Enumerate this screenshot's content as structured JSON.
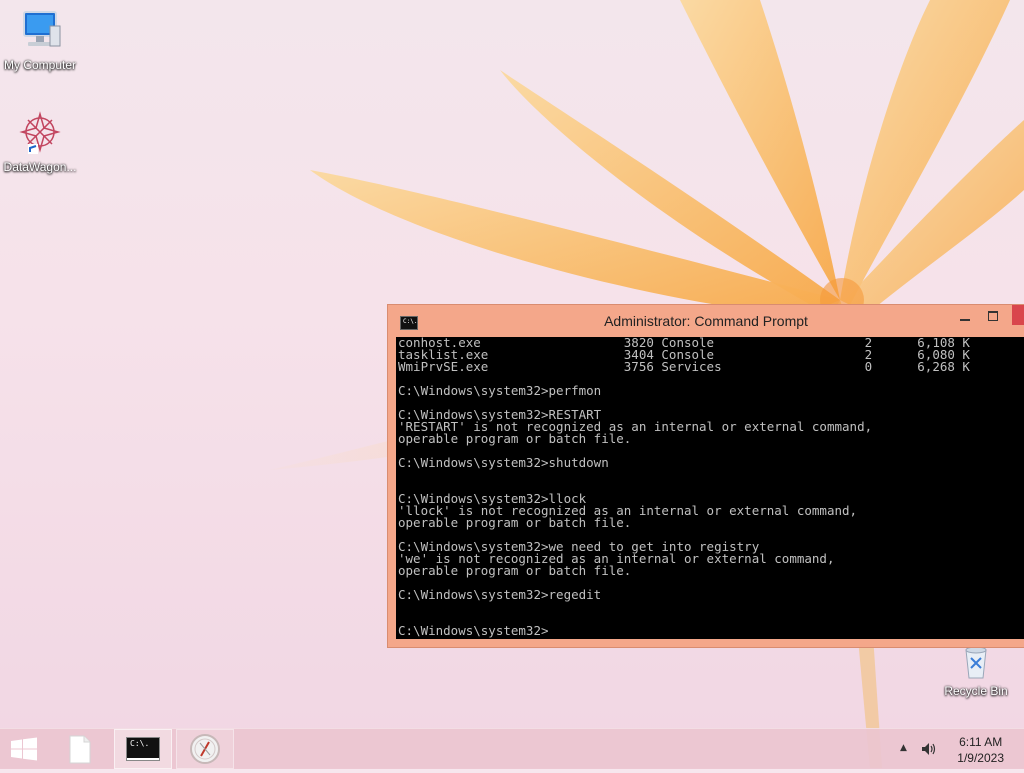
{
  "desktop": {
    "icons": [
      {
        "label": "My Computer",
        "icon": "computer-icon"
      },
      {
        "label": "DataWagon...",
        "icon": "datawagon-icon"
      },
      {
        "label": "Recycle Bin",
        "icon": "recycle-bin-icon"
      }
    ]
  },
  "cmd_window": {
    "title": "Administrator:  Command Prompt",
    "icon": "cmd-icon",
    "sys_icon_text": "C:\\.",
    "lines": [
      "conhost.exe                   3820 Console                    2      6,108 K",
      "tasklist.exe                  3404 Console                    2      6,080 K",
      "WmiPrvSE.exe                  3756 Services                   0      6,268 K",
      "",
      "C:\\Windows\\system32>perfmon",
      "",
      "C:\\Windows\\system32>RESTART",
      "'RESTART' is not recognized as an internal or external command,",
      "operable program or batch file.",
      "",
      "C:\\Windows\\system32>shutdown",
      "",
      "",
      "C:\\Windows\\system32>llock",
      "'llock' is not recognized as an internal or external command,",
      "operable program or batch file.",
      "",
      "C:\\Windows\\system32>we need to get into registry",
      "'we' is not recognized as an internal or external command,",
      "operable program or batch file.",
      "",
      "C:\\Windows\\system32>regedit",
      "",
      "",
      "C:\\Windows\\system32>"
    ]
  },
  "taskbar": {
    "items": [
      {
        "name": "start",
        "icon": "windows-logo-icon"
      },
      {
        "name": "file-explorer",
        "icon": "file-icon"
      },
      {
        "name": "command-prompt",
        "icon": "cmd-icon",
        "text": "C:\\."
      },
      {
        "name": "app",
        "icon": "compass-icon"
      }
    ],
    "tray": {
      "chevron": "▲",
      "clock_time": "6:11 AM",
      "clock_date": "1/9/2023"
    }
  },
  "colors": {
    "titlebar": "#f4a78a",
    "taskbar": "#ebc6d0",
    "console_bg": "#000000",
    "console_fg": "#c0c0c0"
  }
}
